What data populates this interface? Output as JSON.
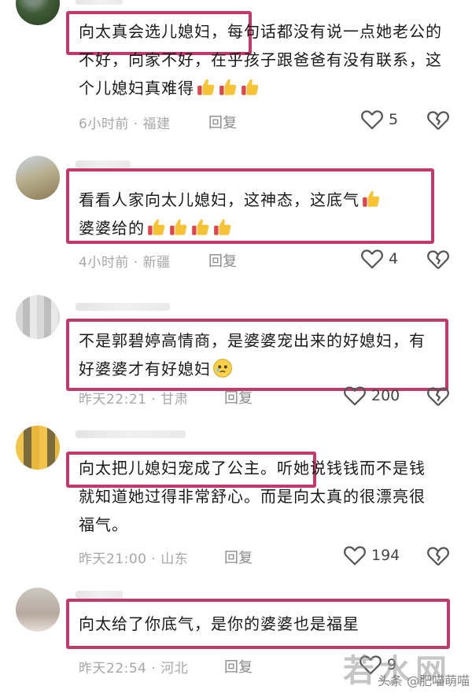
{
  "comments": [
    {
      "text": "向太真会选儿媳妇，每句话都没有说一点她老公的不好，向家不好，在乎孩子跟爸爸有没有联系，这个儿媳妇真难得",
      "time": "6小时前",
      "location": "福建",
      "reply_label": "回复",
      "likes": "5",
      "emoji_thumbs": 3
    },
    {
      "text": "看看人家向太儿媳妇，这神态，这底气",
      "text2": "婆婆给的",
      "time": "4小时前",
      "location": "新疆",
      "reply_label": "回复",
      "likes": "4"
    },
    {
      "text": "不是郭碧婷高情商，是婆婆宠出来的好媳妇，有好婆婆才有好媳妇",
      "time": "昨天22:21",
      "location": "甘肃",
      "reply_label": "回复",
      "likes": "200"
    },
    {
      "text": "向太把儿媳妇宠成了公主。听她说钱钱而不是钱就知道她过得非常舒心。而是向太真的很漂亮很福气。",
      "time": "昨天21:00",
      "location": "山东",
      "reply_label": "回复",
      "likes": "194"
    },
    {
      "text": "向太给了你底气，是你的婆婆也是福星",
      "time": "昨天22:54",
      "location": "河北",
      "reply_label": "回复",
      "likes": "9"
    }
  ],
  "separator": " · ",
  "icons": {
    "like": "heart-outline-icon",
    "dislike": "broken-heart-icon"
  },
  "colors": {
    "highlight": "#c23a6b",
    "meta": "#a7a7a7"
  },
  "watermark": {
    "logo": "若水网",
    "caption": "头条 @肥喵萌喵"
  }
}
